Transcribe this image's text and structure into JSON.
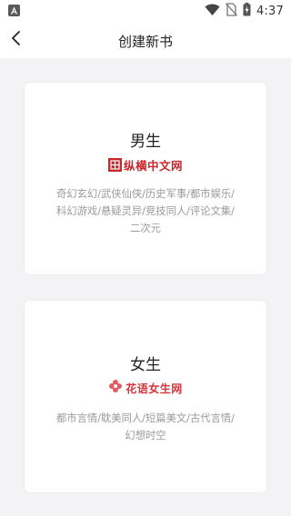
{
  "status_bar": {
    "time": "4:37",
    "icons": [
      "app-notification-icon",
      "wifi-icon",
      "no-sim-icon",
      "battery-charging-icon"
    ]
  },
  "header": {
    "title": "创建新书",
    "back_icon": "chevron-left-icon"
  },
  "cards": {
    "male": {
      "title": "男生",
      "logo_text": "纵横中文网",
      "genres": "奇幻玄幻/武侠仙侠/历史军事/都市娱乐/科幻游戏/悬疑灵异/竞技同人/评论文集/二次元"
    },
    "female": {
      "title": "女生",
      "logo_text": "花语女生网",
      "genres": "都市言情/耽美同人/短篇美文/古代言情/幻想时空"
    }
  },
  "colors": {
    "background": "#f3f3f5",
    "card": "#ffffff",
    "zongheng_red": "#c9272b",
    "huayu_red": "#d9343a",
    "muted_text": "#9a9a9a"
  }
}
